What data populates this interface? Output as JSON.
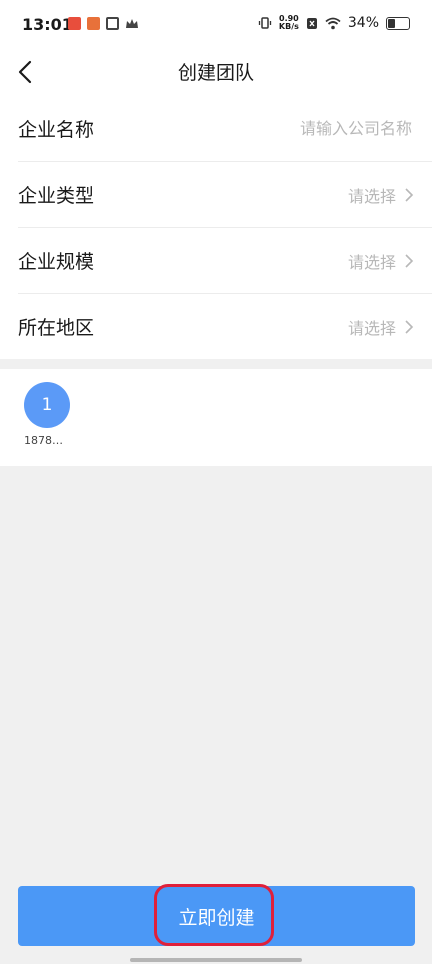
{
  "status_bar": {
    "time": "13:01",
    "net_speed_value": "0.90",
    "net_speed_unit": "KB/s",
    "battery": "34%",
    "battery_level": 0.34
  },
  "nav": {
    "title": "创建团队"
  },
  "form": {
    "company_name": {
      "label": "企业名称",
      "placeholder": "请输入公司名称",
      "value": ""
    },
    "company_type": {
      "label": "企业类型",
      "value": "请选择"
    },
    "company_size": {
      "label": "企业规模",
      "value": "请选择"
    },
    "region": {
      "label": "所在地区",
      "value": "请选择"
    }
  },
  "members": [
    {
      "avatar_text": "1",
      "name": "1878…"
    }
  ],
  "submit": {
    "label": "立即创建"
  },
  "colors": {
    "primary": "#4b98f6",
    "avatar": "#5b9af7",
    "highlight": "#e0203a",
    "placeholder": "#b8b8b8"
  }
}
